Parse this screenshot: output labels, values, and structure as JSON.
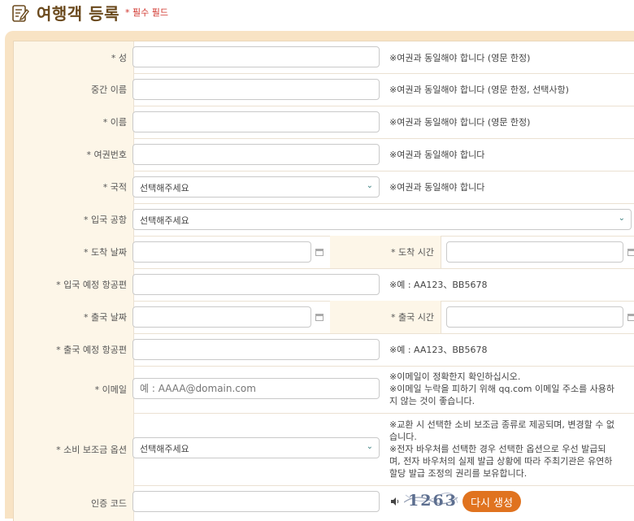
{
  "header": {
    "title": "여행객 등록",
    "required_note": "* 필수 필드"
  },
  "rows": {
    "last_name": {
      "label": "* 성",
      "note": "※여권과 동일해야 합니다 (영문 한정)"
    },
    "middle_name": {
      "label": "중간 이름",
      "note": "※여권과 동일해야 합니다 (영문 한정, 선택사항)"
    },
    "first_name": {
      "label": "* 이름",
      "note": "※여권과 동일해야 합니다 (영문 한정)"
    },
    "passport": {
      "label": "* 여권번호",
      "note": "※여권과 동일해야 합니다"
    },
    "nationality": {
      "label": "* 국적",
      "value": "선택해주세요",
      "note": "※여권과 동일해야 합니다"
    },
    "airport": {
      "label": "* 입국 공항",
      "value": "선택해주세요"
    },
    "arrival": {
      "date_label": "* 도착 날짜",
      "time_label": "* 도착 시간"
    },
    "arrival_flight": {
      "label": "* 입국 예정 항공편",
      "note": "※예 : AA123、BB5678"
    },
    "departure": {
      "date_label": "* 출국 날짜",
      "time_label": "* 출국 시간"
    },
    "departure_flight": {
      "label": "* 출국 예정 항공편",
      "note": "※예 : AA123、BB5678"
    },
    "email": {
      "label": "* 이메일",
      "placeholder": "예 : AAAA@domain.com",
      "note1": "※이메일이 정확한지 확인하십시오.",
      "note2": "※이메일 누락을 피하기 위해 qq.com 이메일 주소를 사용하",
      "note3": "지 않는 것이 좋습니다."
    },
    "subsidy": {
      "label": "* 소비 보조금 옵션",
      "value": "선택해주세요",
      "note1": "※교환 시 선택한 소비 보조금 종류로 제공되며, 변경할 수 없",
      "note2": "습니다.",
      "note3": "※전자 바우처를 선택한 경우 선택한 옵션으로 우선 발급되",
      "note4": "며, 전자 바우처의 실제 발급 상황에 따라 주최기관은 유연하",
      "note5": "할당 발급 조정의 권리를 보유합니다."
    },
    "captcha": {
      "label": "인증 코드",
      "code": "1263",
      "regen_label": "다시 생성"
    }
  },
  "colors": {
    "title": "#6b4a1e",
    "required": "#d0342c",
    "button": "#e0731f",
    "label_bg": "#fdf6e8"
  }
}
